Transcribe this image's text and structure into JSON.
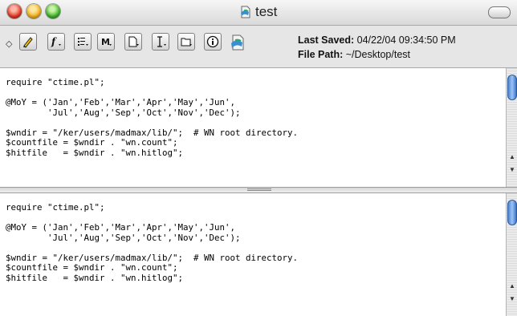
{
  "window": {
    "title": "test"
  },
  "toolbar": {
    "buttons": [
      {
        "name": "pencil-button",
        "icon": "pencil-icon"
      },
      {
        "name": "function-popup",
        "icon": "function-icon"
      },
      {
        "name": "markers-popup",
        "icon": "markers-icon"
      },
      {
        "name": "m-popup",
        "icon": "m-icon"
      },
      {
        "name": "document-popup",
        "icon": "document-icon"
      },
      {
        "name": "text-cursor-popup",
        "icon": "text-cursor-icon"
      },
      {
        "name": "folder-popup",
        "icon": "folder-icon"
      },
      {
        "name": "info-button",
        "icon": "info-icon"
      },
      {
        "name": "proxy-icon",
        "icon": "document-proxy-icon"
      }
    ],
    "last_saved_label": "Last Saved:",
    "last_saved_value": "04/22/04 09:34:50 PM",
    "file_path_label": "File Path:",
    "file_path_value": "~/Desktop/test"
  },
  "editor": {
    "top_code": "require \"ctime.pl\";\n\n@MoY = ('Jan','Feb','Mar','Apr','May','Jun',\n        'Jul','Aug','Sep','Oct','Nov','Dec');\n\n$wndir = \"/ker/users/madmax/lib/\";  # WN root directory.\n$countfile = $wndir . \"wn.count\";\n$hitfile   = $wndir . \"wn.hitlog\";",
    "bottom_code": "require \"ctime.pl\";\n\n@MoY = ('Jan','Feb','Mar','Apr','May','Jun',\n        'Jul','Aug','Sep','Oct','Nov','Dec');\n\n$wndir = \"/ker/users/madmax/lib/\";  # WN root directory.\n$countfile = $wndir . \"wn.count\";\n$hitfile   = $wndir . \"wn.hitlog\";"
  }
}
